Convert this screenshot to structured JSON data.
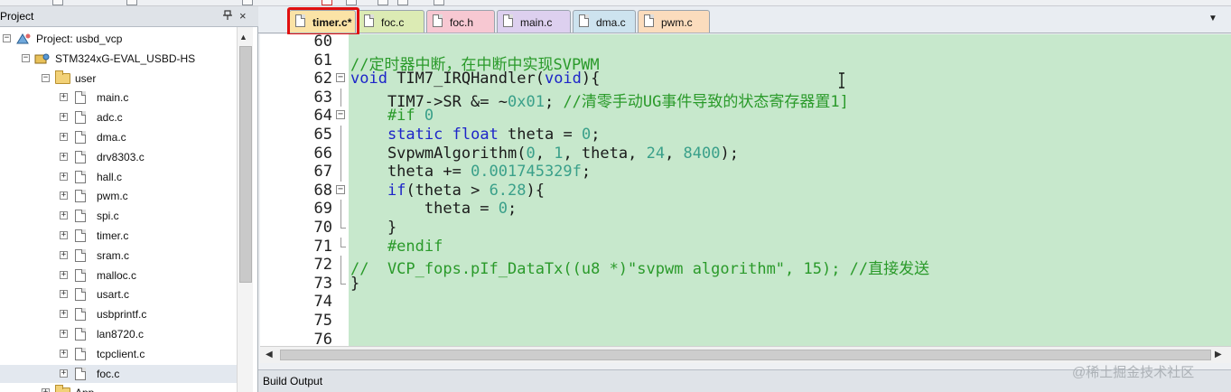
{
  "project_panel": {
    "title": "Project",
    "pin_icon": "pin-icon",
    "close_label": "×",
    "tree": [
      {
        "label": "Project: usbd_vcp",
        "depth": 0,
        "kind": "project",
        "expander": "⊟"
      },
      {
        "label": "STM324xG-EVAL_USBD-HS",
        "depth": 1,
        "kind": "target",
        "expander": "⊟"
      },
      {
        "label": "user",
        "depth": 2,
        "kind": "folder",
        "expander": "⊟"
      },
      {
        "label": "main.c",
        "depth": 3,
        "kind": "file",
        "expander": "+"
      },
      {
        "label": "adc.c",
        "depth": 3,
        "kind": "file",
        "expander": "+"
      },
      {
        "label": "dma.c",
        "depth": 3,
        "kind": "file",
        "expander": "+"
      },
      {
        "label": "drv8303.c",
        "depth": 3,
        "kind": "file",
        "expander": "+"
      },
      {
        "label": "hall.c",
        "depth": 3,
        "kind": "file",
        "expander": "+"
      },
      {
        "label": "pwm.c",
        "depth": 3,
        "kind": "file",
        "expander": "+"
      },
      {
        "label": "spi.c",
        "depth": 3,
        "kind": "file",
        "expander": "+"
      },
      {
        "label": "timer.c",
        "depth": 3,
        "kind": "file",
        "expander": "+"
      },
      {
        "label": "sram.c",
        "depth": 3,
        "kind": "file",
        "expander": "+"
      },
      {
        "label": "malloc.c",
        "depth": 3,
        "kind": "file",
        "expander": "+"
      },
      {
        "label": "usart.c",
        "depth": 3,
        "kind": "file",
        "expander": "+"
      },
      {
        "label": "usbprintf.c",
        "depth": 3,
        "kind": "file",
        "expander": "+"
      },
      {
        "label": "lan8720.c",
        "depth": 3,
        "kind": "file",
        "expander": "+"
      },
      {
        "label": "tcpclient.c",
        "depth": 3,
        "kind": "file",
        "expander": "+"
      },
      {
        "label": "foc.c",
        "depth": 3,
        "kind": "file",
        "expander": "+",
        "selected": true
      },
      {
        "label": "App",
        "depth": 2,
        "kind": "folder",
        "expander": "⊞"
      }
    ]
  },
  "tabs": [
    {
      "label": "timer.c*",
      "color": "#fbe3a6",
      "active": true
    },
    {
      "label": "foc.c",
      "color": "#dcebb4"
    },
    {
      "label": "foc.h",
      "color": "#f7c8d2"
    },
    {
      "label": "main.c",
      "color": "#ddd0ef"
    },
    {
      "label": "dma.c",
      "color": "#cde3ef"
    },
    {
      "label": "pwm.c",
      "color": "#fbdcbd"
    }
  ],
  "tab_dropdown": "▼",
  "code_lines": [
    {
      "num": "60",
      "parts": [],
      "fold": "none"
    },
    {
      "num": "61",
      "parts": [
        {
          "t": "//定时器中断，在中断中实现SVPWM",
          "c": "cm"
        }
      ],
      "fold": "none"
    },
    {
      "num": "62",
      "parts": [
        {
          "t": "void",
          "c": "kw"
        },
        {
          "t": " TIM7_IRQHandler(",
          "c": ""
        },
        {
          "t": "void",
          "c": "kw"
        },
        {
          "t": "){",
          "c": ""
        }
      ],
      "fold": "open"
    },
    {
      "num": "63",
      "parts": [
        {
          "t": "    TIM7->SR &= ~",
          "c": ""
        },
        {
          "t": "0x01",
          "c": "num"
        },
        {
          "t": "; ",
          "c": ""
        },
        {
          "t": "//清零手动UG事件导致的状态寄存器置1]",
          "c": "cm"
        }
      ],
      "fold": "line"
    },
    {
      "num": "64",
      "parts": [
        {
          "t": "    #if ",
          "c": "cm"
        },
        {
          "t": "0",
          "c": "num"
        }
      ],
      "fold": "open"
    },
    {
      "num": "65",
      "parts": [
        {
          "t": "    ",
          "c": ""
        },
        {
          "t": "static",
          "c": "kw"
        },
        {
          "t": " ",
          "c": ""
        },
        {
          "t": "float",
          "c": "kw"
        },
        {
          "t": " theta = ",
          "c": ""
        },
        {
          "t": "0",
          "c": "num"
        },
        {
          "t": ";",
          "c": ""
        }
      ],
      "fold": "line"
    },
    {
      "num": "66",
      "parts": [
        {
          "t": "    SvpwmAlgorithm(",
          "c": ""
        },
        {
          "t": "0",
          "c": "num"
        },
        {
          "t": ", ",
          "c": ""
        },
        {
          "t": "1",
          "c": "num"
        },
        {
          "t": ", theta, ",
          "c": ""
        },
        {
          "t": "24",
          "c": "num"
        },
        {
          "t": ", ",
          "c": ""
        },
        {
          "t": "8400",
          "c": "num"
        },
        {
          "t": ");",
          "c": ""
        }
      ],
      "fold": "line"
    },
    {
      "num": "67",
      "parts": [
        {
          "t": "    theta += ",
          "c": ""
        },
        {
          "t": "0.001745329f",
          "c": "num"
        },
        {
          "t": ";",
          "c": ""
        }
      ],
      "fold": "line"
    },
    {
      "num": "68",
      "parts": [
        {
          "t": "    ",
          "c": ""
        },
        {
          "t": "if",
          "c": "kw"
        },
        {
          "t": "(theta > ",
          "c": ""
        },
        {
          "t": "6.28",
          "c": "num"
        },
        {
          "t": "){",
          "c": ""
        }
      ],
      "fold": "open"
    },
    {
      "num": "69",
      "parts": [
        {
          "t": "        theta = ",
          "c": ""
        },
        {
          "t": "0",
          "c": "num"
        },
        {
          "t": ";",
          "c": ""
        }
      ],
      "fold": "line"
    },
    {
      "num": "70",
      "parts": [
        {
          "t": "    }",
          "c": ""
        }
      ],
      "fold": "end"
    },
    {
      "num": "71",
      "parts": [
        {
          "t": "    #endif",
          "c": "cm"
        }
      ],
      "fold": "end"
    },
    {
      "num": "72",
      "parts": [
        {
          "t": "//  VCP_fops.pIf_DataTx((u8 *)\"svpwm algorithm\", 15); //直接发送",
          "c": "cm"
        }
      ],
      "fold": "line"
    },
    {
      "num": "73",
      "parts": [
        {
          "t": "}",
          "c": ""
        }
      ],
      "fold": "end"
    },
    {
      "num": "74",
      "parts": [],
      "fold": "none"
    },
    {
      "num": "75",
      "parts": [],
      "fold": "none"
    },
    {
      "num": "76",
      "parts": [],
      "fold": "none"
    }
  ],
  "build_output": {
    "title": "Build Output"
  },
  "watermark": "@稀土掘金技术社区"
}
